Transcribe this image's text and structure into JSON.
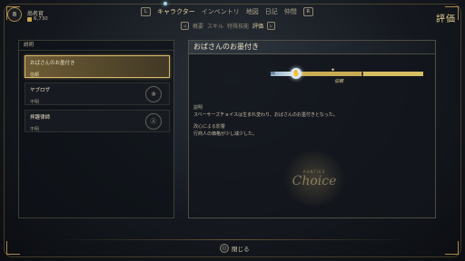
{
  "player": {
    "level": "8",
    "name": "尚名官",
    "gold": "6,730"
  },
  "top_nav": {
    "left_key": "L",
    "right_key": "R",
    "tabs": [
      "キャラクター",
      "インベントリ",
      "地図",
      "日記",
      "仲間"
    ],
    "active": "キャラクター"
  },
  "sub_nav": {
    "left_key": "◁",
    "right_key": "▷",
    "tabs": [
      "概要",
      "スキル",
      "特殊技能",
      "評価"
    ],
    "active": "評価"
  },
  "page_title": "評価",
  "left_panel": {
    "header": "説明",
    "items": [
      {
        "title": "おばさんのお墨付き",
        "status": "信頼",
        "selected": true
      },
      {
        "title": "ヤブロザ",
        "status": "不明",
        "selected": false
      },
      {
        "title": "拝趣律師",
        "status": "不明",
        "selected": false
      }
    ]
  },
  "detail": {
    "title": "おばさんのお墨付き",
    "trust_left_label": "無知",
    "trust_level_label": "信頼",
    "trust_fraction": 0.2,
    "desc_label": "説明",
    "desc_text": "スベーサーズチョイスは生まれ変わり、おばさんのお墨付きとなった。",
    "effect_label": "改心による影響",
    "effect_text": "行商人の価格が少し減少した。",
    "watermark_small": "AUNTIES",
    "watermark_big": "Choice"
  },
  "footer": {
    "close_key": "○",
    "close_label": "閉じる"
  },
  "colors": {
    "accent": "#e5cf8f",
    "selected_border": "#d8b86a",
    "trust_blue": "#dde9f2"
  }
}
